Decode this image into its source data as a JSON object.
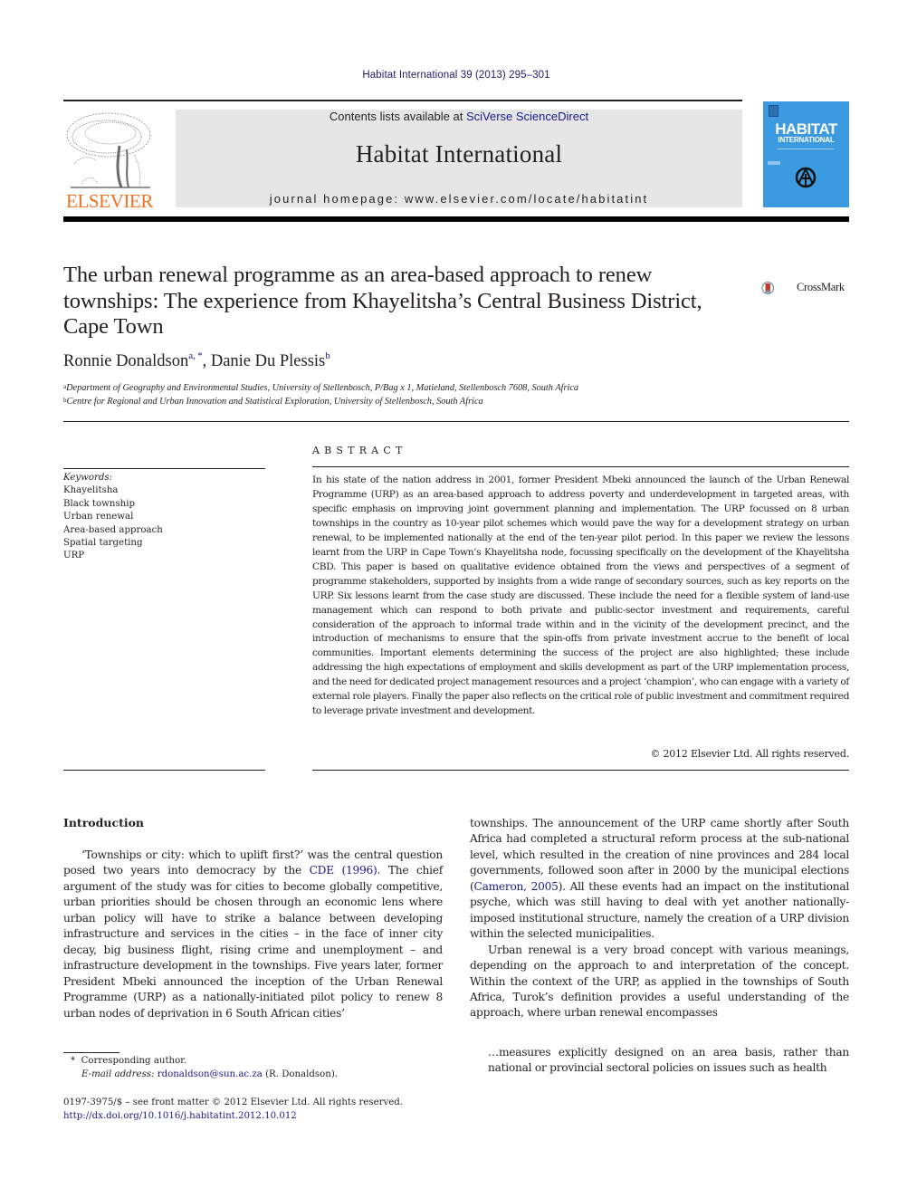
{
  "running_header": "Habitat International 39 (2013) 295–301",
  "masthead": {
    "contents_prefix": "Contents lists available at ",
    "contents_link": "SciVerse ScienceDirect",
    "journal_title": "Habitat International",
    "homepage_prefix": "journal homepage: ",
    "homepage_url": "www.elsevier.com/locate/habitatint",
    "publisher_logo_text": "ELSEVIER",
    "cover": {
      "title_line1": "HABITAT",
      "title_line2": "INTERNATIONAL",
      "color": "#3c9ae0"
    }
  },
  "article": {
    "title": "The urban renewal programme as an area-based approach to renew townships: The experience from Khayelitsha’s Central Business District, Cape Town",
    "crossmark_label": "CrossMark",
    "authors": [
      {
        "name": "Ronnie Donaldson",
        "marks": "a, *"
      },
      {
        "name": "Danie Du Plessis",
        "marks": "b"
      }
    ],
    "author_separator": ", ",
    "affiliations": [
      {
        "mark": "a",
        "text": "Department of Geography and Environmental Studies, University of Stellenbosch, P/Bag x 1, Matieland, Stellenbosch 7608, South Africa"
      },
      {
        "mark": "b",
        "text": "Centre for Regional and Urban Innovation and Statistical Exploration, University of Stellenbosch, South Africa"
      }
    ]
  },
  "keywords": {
    "heading": "Keywords:",
    "items": [
      "Khayelitsha",
      "Black township",
      "Urban renewal",
      "Area-based approach",
      "Spatial targeting",
      "URP"
    ]
  },
  "abstract": {
    "heading": "ABSTRACT",
    "text": "In his state of the nation address in 2001, former President Mbeki announced the launch of the Urban Renewal Programme (URP) as an area-based approach to address poverty and underdevelopment in targeted areas, with specific emphasis on improving joint government planning and implementation. The URP focussed on 8 urban townships in the country as 10-year pilot schemes which would pave the way for a development strategy on urban renewal, to be implemented nationally at the end of the ten-year pilot period. In this paper we review the lessons learnt from the URP in Cape Town’s Khayelitsha node, focussing specifically on the development of the Khayelitsha CBD. This paper is based on qualitative evidence obtained from the views and perspectives of a segment of programme stakeholders, supported by insights from a wide range of secondary sources, such as key reports on the URP. Six lessons learnt from the case study are discussed. These include the need for a flexible system of land-use management which can respond to both private and public-sector investment and requirements, careful consideration of the approach to informal trade within and in the vicinity of the development precinct, and the introduction of mechanisms to ensure that the spin-offs from private investment accrue to the benefit of local communities. Important elements determining the success of the project are also highlighted; these include addressing the high expectations of employment and skills development as part of the URP implementation process, and the need for dedicated project management resources and a project ‘champion’, who can engage with a variety of external role players. Finally the paper also reflects on the critical role of public investment and commitment required to leverage private investment and development.",
    "copyright": "© 2012 Elsevier Ltd. All rights reserved."
  },
  "body": {
    "section_heading": "Introduction",
    "p1_a": "‘Townships or city: which to uplift first?’ was the central question posed two years into democracy by the ",
    "p1_link": "CDE (1996)",
    "p1_b": ". The chief argument of the study was for cities to become globally competitive, urban priorities should be chosen through an economic lens where urban policy will have to strike a balance between developing infrastructure and services in the cities – in the face of inner city decay, big business flight, rising crime and unemployment – and infrastructure development in the townships. Five years later, former President Mbeki announced the inception of the Urban Renewal Programme (URP) as a nationally-initiated pilot policy to renew 8 urban nodes of deprivation in 6 South African cities’",
    "p2_a": "townships. The announcement of the URP came shortly after South Africa had completed a structural reform process at the sub-national level, which resulted in the creation of nine provinces and 284 local governments, followed soon after in 2000 by the municipal elections (",
    "p2_link": "Cameron, 2005",
    "p2_b": "). All these events had an impact on the institutional psyche, which was still having to deal with yet another nationally-imposed institutional structure, namely the creation of a URP division within the selected municipalities.",
    "p3": "Urban renewal is a very broad concept with various meanings, depending on the approach to and interpretation of the concept. Within the context of the URP, as applied in the townships of South Africa, Turok’s definition provides a useful understanding of the approach, where urban renewal encompasses",
    "quote": "…measures explicitly designed on an area basis, rather than national or provincial sectoral policies on issues such as health"
  },
  "footnotes": {
    "corresponding_mark": "*",
    "corresponding_text": "Corresponding author.",
    "email_label": "E-mail address:",
    "email": "rdonaldson@sun.ac.za",
    "email_owner": " (R. Donaldson).",
    "front_matter": "0197-3975/$ – see front matter © 2012 Elsevier Ltd. All rights reserved.",
    "doi": "http://dx.doi.org/10.1016/j.habitatint.2012.10.012"
  }
}
